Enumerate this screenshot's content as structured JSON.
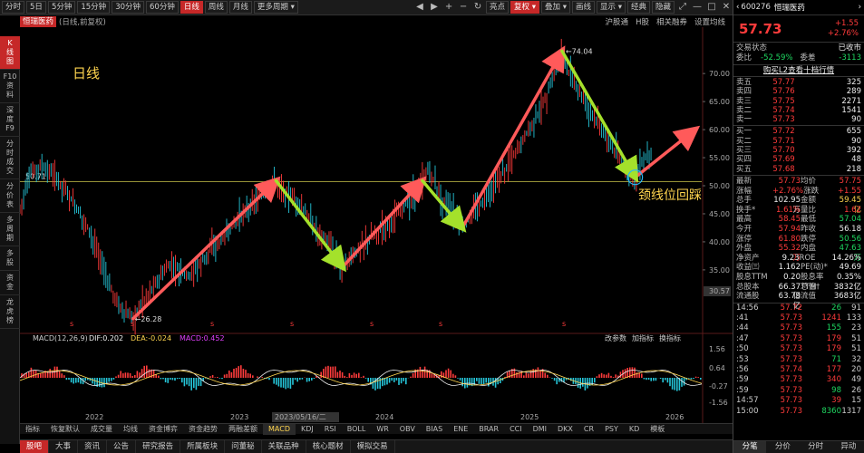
{
  "toolbar": {
    "periods": [
      "分时",
      "5日",
      "5分钟",
      "15分钟",
      "30分钟",
      "60分钟",
      "日线",
      "周线",
      "月线",
      "更多周期 ▾"
    ],
    "active_period": "日线",
    "right_items": [
      "亮点",
      "复权 ▾",
      "叠加 ▾",
      "画线",
      "显示 ▾",
      "经典",
      "隐藏"
    ],
    "active_right": "复权 ▾",
    "nav_icons": [
      "chevron-left-icon",
      "chevron-right-icon",
      "zoom-in-icon",
      "zoom-out-icon",
      "refresh-icon",
      "expand-icon",
      "minimize-icon",
      "maximize-icon",
      "close-icon"
    ]
  },
  "chart_header": {
    "name": "恒瑞医药",
    "subtitle": "(日线,前复权)",
    "links": [
      "沪股通",
      "H股",
      "相关融券",
      "设置均线"
    ]
  },
  "left_tabs": [
    "K\n线\n图",
    "F10\n资\n料",
    "深\n度\nF9",
    "分\n时\n成\n交",
    "分\n价\n表",
    "多\n周\n期",
    "多\n股",
    "资\n金",
    "龙\n虎\n榜"
  ],
  "active_left_tab": 0,
  "annotations": {
    "period_label": "日线",
    "neckline_label": "颈线位回踩",
    "neckline_value": "50.71",
    "high_label": "74.04",
    "low_label": "26.28",
    "right_axis_marker": "30.57"
  },
  "macd": {
    "name": "MACD(12,26,9)",
    "dif": "DIF:0.202",
    "dea": "DEA:-0.024",
    "macd": "MACD:0.452",
    "controls": [
      "改参数",
      "加指标",
      "换指标"
    ],
    "axis": [
      "1.56",
      "0.64",
      "-0.27",
      "-1.56"
    ]
  },
  "chart_data": {
    "type": "line",
    "x_years": [
      "2022",
      "2023",
      "2024",
      "2025",
      "2026"
    ],
    "date_cursor": "2023/05/16/二",
    "y_ticks": [
      70.0,
      65.0,
      60.0,
      55.0,
      50.0,
      45.0,
      40.0,
      35.0
    ],
    "y_tick_labels": [
      "70.00",
      "65.00",
      "60.00",
      "55.00",
      "50.00",
      "45.00",
      "40.00",
      "35.00"
    ],
    "ylim": [
      24,
      76
    ],
    "price_series": [
      [
        0,
        46
      ],
      [
        3,
        52
      ],
      [
        6,
        53.5
      ],
      [
        10,
        52
      ],
      [
        14,
        49
      ],
      [
        18,
        45
      ],
      [
        21,
        42
      ],
      [
        24,
        37
      ],
      [
        27,
        32
      ],
      [
        30,
        28.5
      ],
      [
        32,
        27
      ],
      [
        34,
        26.3
      ],
      [
        36,
        28.5
      ],
      [
        39,
        31
      ],
      [
        42,
        33.5
      ],
      [
        45,
        36
      ],
      [
        48,
        35
      ],
      [
        51,
        34
      ],
      [
        54,
        36
      ],
      [
        57,
        38.5
      ],
      [
        60,
        40
      ],
      [
        63,
        42
      ],
      [
        66,
        44.5
      ],
      [
        69,
        46
      ],
      [
        72,
        48
      ],
      [
        75,
        49.5
      ],
      [
        77,
        50.9
      ],
      [
        79,
        49
      ],
      [
        82,
        48
      ],
      [
        85,
        46
      ],
      [
        88,
        43
      ],
      [
        91,
        41
      ],
      [
        94,
        38.5
      ],
      [
        96,
        36
      ],
      [
        97,
        35.5
      ],
      [
        100,
        37.5
      ],
      [
        103,
        39.5
      ],
      [
        106,
        41
      ],
      [
        109,
        42.5
      ],
      [
        112,
        44
      ],
      [
        115,
        46
      ],
      [
        118,
        48
      ],
      [
        121,
        50.9
      ],
      [
        123,
        53
      ],
      [
        125,
        50
      ],
      [
        127,
        47.5
      ],
      [
        130,
        45.5
      ],
      [
        132,
        43.5
      ],
      [
        133,
        42.5
      ],
      [
        136,
        45
      ],
      [
        139,
        47
      ],
      [
        142,
        49.5
      ],
      [
        145,
        52
      ],
      [
        148,
        55
      ],
      [
        151,
        58
      ],
      [
        154,
        61
      ],
      [
        157,
        64
      ],
      [
        160,
        68.5
      ],
      [
        162,
        72.8
      ],
      [
        163,
        74
      ],
      [
        165,
        70
      ],
      [
        168,
        67
      ],
      [
        171,
        64
      ],
      [
        174,
        61
      ],
      [
        177,
        58
      ],
      [
        180,
        55
      ],
      [
        183,
        52.5
      ],
      [
        185,
        51.5
      ],
      [
        187,
        54
      ],
      [
        190,
        56.5
      ]
    ],
    "support_line_y": 50.71,
    "up_arrows": [
      [
        [
          34,
          26.3
        ],
        [
          77,
          50.9
        ]
      ],
      [
        [
          97,
          35.5
        ],
        [
          121,
          50.9
        ]
      ],
      [
        [
          133,
          42.5
        ],
        [
          163,
          74
        ]
      ],
      [
        [
          185,
          51.5
        ],
        [
          203,
          60
        ]
      ]
    ],
    "down_arrows": [
      [
        [
          77,
          50.9
        ],
        [
          97,
          35.5
        ]
      ],
      [
        [
          121,
          50.9
        ],
        [
          133,
          42.5
        ]
      ],
      [
        [
          163,
          74
        ],
        [
          185,
          51.5
        ]
      ]
    ],
    "colors": {
      "up_arrow": "#ff5a5a",
      "down_arrow": "#a4e12b",
      "support": "#c9c24a",
      "price": "#ff4040"
    }
  },
  "indicator_tabs": [
    "指标",
    "恢复默认",
    "成交量",
    "均线",
    "资金博弈",
    "资金趋势",
    "两融差额",
    "MACD",
    "KDJ",
    "RSI",
    "BOLL",
    "WR",
    "OBV",
    "BIAS",
    "ENE",
    "BRAR",
    "CCI",
    "DMI",
    "DKX",
    "CR",
    "PSY",
    "KD",
    "模板"
  ],
  "active_indicator": "MACD",
  "bottom_nav": [
    "股吧",
    "大事",
    "资讯",
    "公告",
    "研究报告",
    "所属板块",
    "问董秘",
    "关联品种",
    "核心题材",
    "模拟交易"
  ],
  "active_nav": "股吧",
  "right_panel": {
    "code": "600276",
    "name": "恒瑞医药",
    "price": "57.73",
    "change": "+1.55",
    "change_pct": "+2.76%",
    "status_label": "交易状态",
    "status_value": "已收市",
    "weibi_label": "委比",
    "weibi_value": "-52.59%",
    "weicha_label": "委差",
    "weicha_value": "-3113",
    "l2_banner": "购买L2查看十档行情",
    "asks": [
      [
        "卖五",
        "57.77",
        "325"
      ],
      [
        "卖四",
        "57.76",
        "289"
      ],
      [
        "卖三",
        "57.75",
        "2271"
      ],
      [
        "卖二",
        "57.74",
        "1541"
      ],
      [
        "卖一",
        "57.73",
        "90"
      ]
    ],
    "bids": [
      [
        "买一",
        "57.72",
        "655"
      ],
      [
        "买二",
        "57.71",
        "90"
      ],
      [
        "买三",
        "57.70",
        "392"
      ],
      [
        "买四",
        "57.69",
        "48"
      ],
      [
        "买五",
        "57.68",
        "218"
      ]
    ],
    "quotes": [
      [
        "最新",
        "57.73",
        "均价",
        "57.75"
      ],
      [
        "涨幅",
        "+2.76%",
        "涨跌",
        "+1.55"
      ],
      [
        "总手",
        "102.95万",
        "金额",
        "59.45亿"
      ],
      [
        "换手*",
        "1.61%",
        "量比",
        "1.62"
      ],
      [
        "最高",
        "58.45",
        "最低",
        "57.04"
      ],
      [
        "今开",
        "57.94",
        "昨收",
        "56.18"
      ],
      [
        "涨停",
        "61.80",
        "跌停",
        "50.56"
      ],
      [
        "外盘",
        "55.32万",
        "内盘",
        "47.63万"
      ],
      [
        "净资产",
        "9.23",
        "ROE",
        "14.26%"
      ],
      [
        "收益㈢",
        "1.162",
        "PE(动)*",
        "49.69"
      ],
      [
        "股息TTM",
        "0.20",
        "股息率TTM",
        "0.35%"
      ],
      [
        "总股本",
        "66.37亿",
        "总值†",
        "3832亿"
      ],
      [
        "流通股",
        "63.79亿",
        "流值",
        "3683亿"
      ]
    ],
    "ticks": [
      [
        "14:56",
        "57.72",
        "26",
        "91"
      ],
      [
        ":41",
        "57.73",
        "1241",
        "133"
      ],
      [
        ":44",
        "57.73",
        "155",
        "23"
      ],
      [
        ":47",
        "57.73",
        "179",
        "51"
      ],
      [
        ":50",
        "57.73",
        "179",
        "51"
      ],
      [
        ":53",
        "57.73",
        "71",
        "32"
      ],
      [
        ":56",
        "57.74",
        "177",
        "20"
      ],
      [
        ":59",
        "57.73",
        "340",
        "49"
      ],
      [
        ":59",
        "57.73",
        "98",
        "26"
      ],
      [
        "14:57",
        "57.73",
        "39",
        "15"
      ],
      [
        "15:00",
        "57.73",
        "8360",
        "1317"
      ]
    ],
    "tick_dir": [
      "green",
      "red",
      "green",
      "red",
      "red",
      "green",
      "red",
      "red",
      "green",
      "red",
      "green"
    ],
    "tabs": [
      "分笔",
      "分价",
      "分时",
      "异动"
    ],
    "active_tab": "分笔"
  }
}
